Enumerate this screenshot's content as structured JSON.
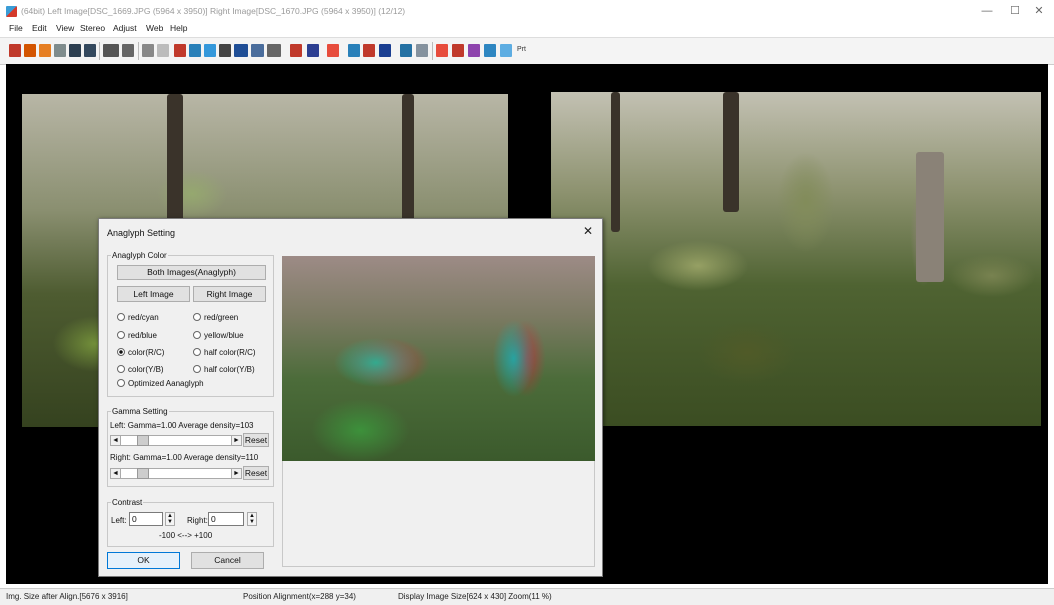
{
  "window": {
    "title": "(64bit) Left Image[DSC_1669.JPG (5964 x 3950)] Right Image[DSC_1670.JPG (5964 x 3950)] (12/12)",
    "minimize": "—",
    "maximize": "☐",
    "close": "✕"
  },
  "menu": [
    "File",
    "Edit",
    "View",
    "Stereo",
    "Adjust",
    "Web",
    "Help"
  ],
  "toolbar": {
    "text_button": "Prt"
  },
  "dialog": {
    "title": "Anaglyph Setting",
    "close": "✕",
    "anaglyph_color": {
      "label": "Anaglyph Color",
      "both_button": "Both Images(Anaglyph)",
      "left_button": "Left Image",
      "right_button": "Right Image",
      "options": [
        {
          "label": "red/cyan",
          "selected": false
        },
        {
          "label": "red/green",
          "selected": false
        },
        {
          "label": "red/blue",
          "selected": false
        },
        {
          "label": "yellow/blue",
          "selected": false
        },
        {
          "label": "color(R/C)",
          "selected": true
        },
        {
          "label": "half color(R/C)",
          "selected": false
        },
        {
          "label": "color(Y/B)",
          "selected": false
        },
        {
          "label": "half color(Y/B)",
          "selected": false
        },
        {
          "label": "Optimized Aanaglyph",
          "selected": false
        }
      ]
    },
    "gamma": {
      "label": "Gamma Setting",
      "left_text": "Left:  Gamma=1.00 Average density=103",
      "right_text": "Right: Gamma=1.00 Average density=110",
      "reset": "Reset",
      "left_arrow": "◄",
      "right_arrow": "►"
    },
    "contrast": {
      "label": "Contrast",
      "left_label": "Left:",
      "left_value": "0",
      "right_label": "Right:",
      "right_value": "0",
      "range": "-100 <--> +100"
    },
    "ok": "OK",
    "cancel": "Cancel"
  },
  "status": {
    "size_after_align": "Img. Size after Align.[5676 x 3916]",
    "position": "Position Alignment(x=288 y=34)",
    "display": "Display Image Size[624 x 430]  Zoom(11 %)"
  }
}
